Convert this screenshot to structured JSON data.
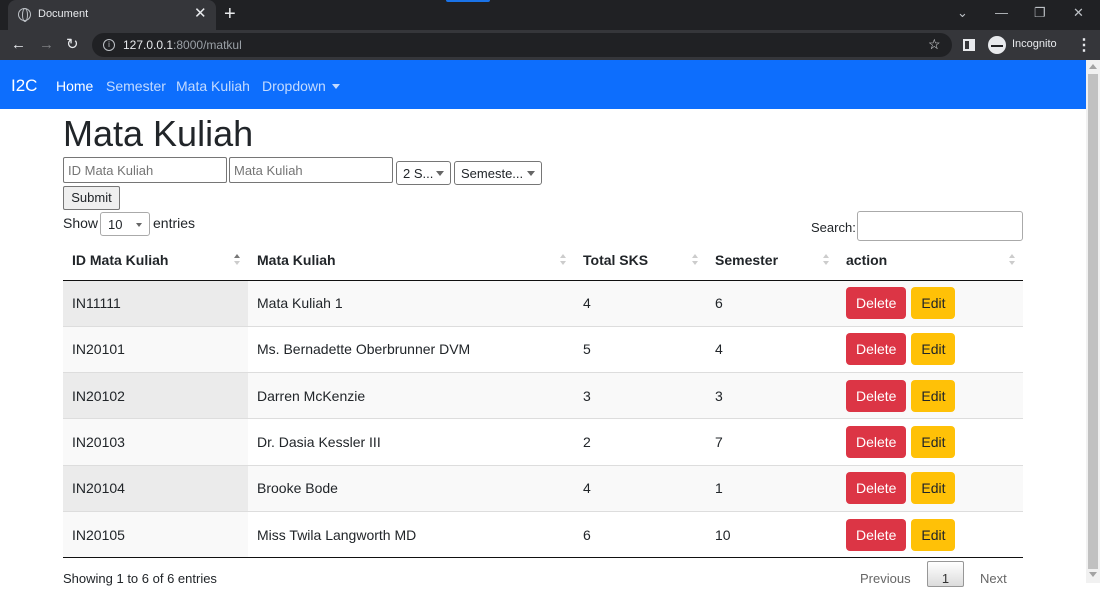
{
  "browser": {
    "tab_title": "Document",
    "url_host": "127.0.0.1",
    "url_path": ":8000/matkul",
    "profile": "Incognito"
  },
  "navbar": {
    "brand": "I2C",
    "links": [
      "Home",
      "Semester",
      "Mata Kuliah",
      "Dropdown"
    ]
  },
  "page": {
    "title": "Mata Kuliah",
    "form": {
      "id_placeholder": "ID Mata Kuliah",
      "name_placeholder": "Mata Kuliah",
      "sks_selected": "2 S...",
      "semester_selected": "Semeste...",
      "submit": "Submit"
    },
    "datatable": {
      "show_label": "Show",
      "length": "10",
      "entries_label": "entries",
      "search_label": "Search:",
      "columns": [
        "ID Mata Kuliah",
        "Mata Kuliah",
        "Total SKS",
        "Semester",
        "action"
      ],
      "rows": [
        {
          "id": "IN11111",
          "name": "Mata Kuliah 1",
          "sks": "4",
          "semester": "6"
        },
        {
          "id": "IN20101",
          "name": "Ms. Bernadette Oberbrunner DVM",
          "sks": "5",
          "semester": "4"
        },
        {
          "id": "IN20102",
          "name": "Darren McKenzie",
          "sks": "3",
          "semester": "3"
        },
        {
          "id": "IN20103",
          "name": "Dr. Dasia Kessler III",
          "sks": "2",
          "semester": "7"
        },
        {
          "id": "IN20104",
          "name": "Brooke Bode",
          "sks": "4",
          "semester": "1"
        },
        {
          "id": "IN20105",
          "name": "Miss Twila Langworth MD",
          "sks": "6",
          "semester": "10"
        }
      ],
      "delete_label": "Delete",
      "edit_label": "Edit",
      "info": "Showing 1 to 6 of 6 entries",
      "prev": "Previous",
      "current_page": "1",
      "next": "Next"
    }
  }
}
